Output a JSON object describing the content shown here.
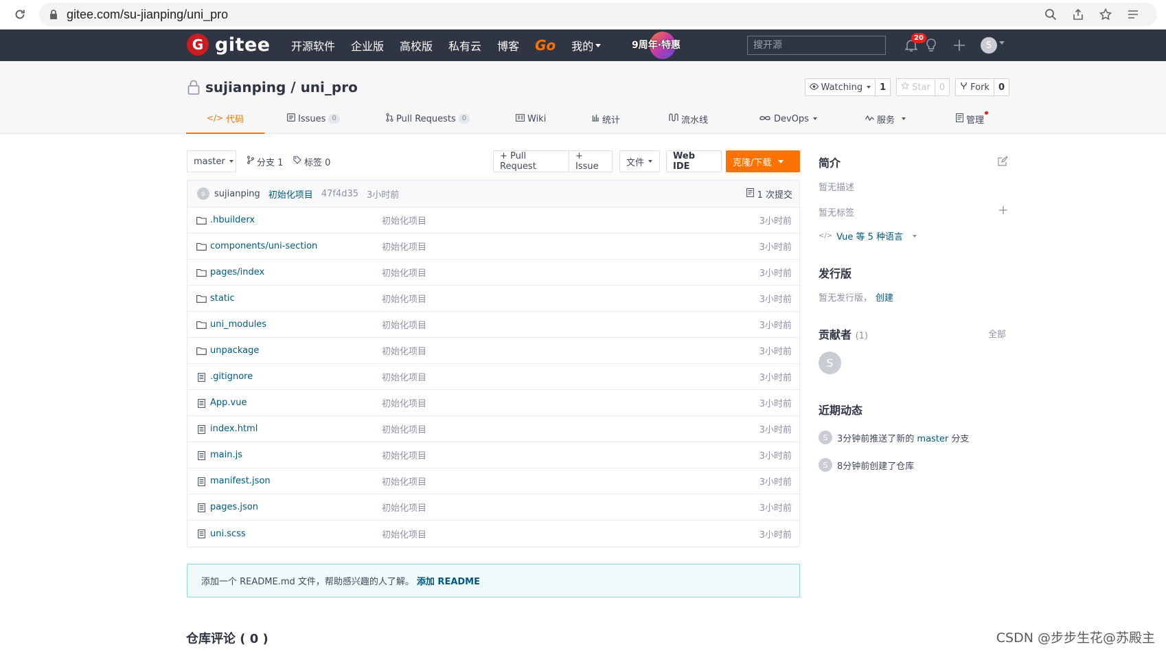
{
  "browser": {
    "url": "gitee.com/su-jianping/uni_pro"
  },
  "header": {
    "logo_text": "gitee",
    "nav": [
      "开源软件",
      "企业版",
      "高校版",
      "私有云",
      "博客"
    ],
    "nav_go": "Go",
    "nav_mine": "我的",
    "promo": "9周年·特惠",
    "search_placeholder": "搜开源",
    "notification_count": "20",
    "avatar_letter": "S",
    "accent": "#fe7300",
    "background": "#2f3542"
  },
  "project": {
    "owner": "sujianping",
    "separator": " / ",
    "name": "uni_pro",
    "watching_label": "Watching",
    "watching_count": "1",
    "star_label": "Star",
    "star_count": "0",
    "fork_label": "Fork",
    "fork_count": "0",
    "tabs": [
      {
        "label": "代码",
        "icon": "code-icon"
      },
      {
        "label": "Issues",
        "count": "0",
        "icon": "issue-icon"
      },
      {
        "label": "Pull Requests",
        "count": "0",
        "icon": "pull-request-icon"
      },
      {
        "label": "Wiki",
        "icon": "wiki-icon"
      },
      {
        "label": "统计",
        "icon": "chart-icon"
      },
      {
        "label": "流水线",
        "icon": "pipeline-icon"
      },
      {
        "label": "DevOps",
        "icon": "infinity-icon"
      },
      {
        "label": "服务",
        "icon": "service-icon"
      },
      {
        "label": "管理",
        "icon": "manage-icon"
      }
    ]
  },
  "toolbar": {
    "branch": "master",
    "branches": "分支 1",
    "tags": "标签 0",
    "pull_request": "+ Pull Request",
    "issue": "+ Issue",
    "file_menu": "文件",
    "web_ide": "Web IDE",
    "clone": "克隆/下载"
  },
  "commit": {
    "avatar_letter": "s",
    "author": "sujianping",
    "message": "初始化项目",
    "sha": "47f4d35",
    "time": "3小时前",
    "count": "1 次提交"
  },
  "files": [
    {
      "name": ".hbuilderx",
      "type": "folder",
      "message": "初始化项目",
      "time": "3小时前"
    },
    {
      "name": "components/uni-section",
      "type": "folder",
      "message": "初始化项目",
      "time": "3小时前"
    },
    {
      "name": "pages/index",
      "type": "folder",
      "message": "初始化项目",
      "time": "3小时前"
    },
    {
      "name": "static",
      "type": "folder",
      "message": "初始化项目",
      "time": "3小时前"
    },
    {
      "name": "uni_modules",
      "type": "folder",
      "message": "初始化项目",
      "time": "3小时前"
    },
    {
      "name": "unpackage",
      "type": "folder",
      "message": "初始化项目",
      "time": "3小时前"
    },
    {
      "name": ".gitignore",
      "type": "file",
      "message": "初始化项目",
      "time": "3小时前"
    },
    {
      "name": "App.vue",
      "type": "file",
      "message": "初始化项目",
      "time": "3小时前"
    },
    {
      "name": "index.html",
      "type": "file",
      "message": "初始化项目",
      "time": "3小时前"
    },
    {
      "name": "main.js",
      "type": "file",
      "message": "初始化项目",
      "time": "3小时前"
    },
    {
      "name": "manifest.json",
      "type": "file",
      "message": "初始化项目",
      "time": "3小时前"
    },
    {
      "name": "pages.json",
      "type": "file",
      "message": "初始化项目",
      "time": "3小时前"
    },
    {
      "name": "uni.scss",
      "type": "file",
      "message": "初始化项目",
      "time": "3小时前"
    }
  ],
  "readme_tip": {
    "text": "添加一个 README.md 文件，帮助感兴趣的人了解。",
    "link": "添加 README"
  },
  "comments_title": "仓库评论 ( 0 )",
  "sidebar": {
    "intro_title": "简介",
    "no_desc": "暂无描述",
    "no_tags": "暂无标签",
    "language": "Vue 等 5 种语言",
    "releases_title": "发行版",
    "no_releases": "暂无发行版，",
    "create_link": "创建",
    "contributors_title": "贡献者",
    "contributors_count": "(1)",
    "all_link": "全部",
    "contributor_letter": "S",
    "activity_title": "近期动态",
    "activity": [
      {
        "avatar": "S",
        "text_before": "3分钟前推送了新的 ",
        "branch": "master",
        "text_after": " 分支"
      },
      {
        "avatar": "S",
        "text_before": "8分钟前创建了仓库",
        "branch": "",
        "text_after": ""
      }
    ]
  },
  "watermark": "CSDN @步步生花@苏殿主"
}
